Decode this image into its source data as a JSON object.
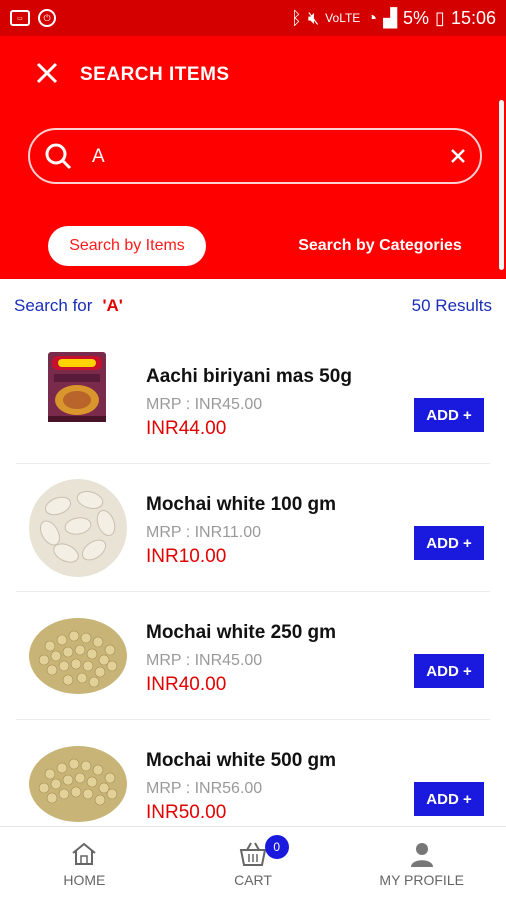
{
  "status_bar": {
    "battery": "5%",
    "time": "15:06",
    "network": "VoLTE"
  },
  "header": {
    "title": "SEARCH ITEMS",
    "search_value": "A",
    "tabs": [
      {
        "label": "Search by Items",
        "active": true
      },
      {
        "label": "Search by Categories",
        "active": false
      }
    ]
  },
  "results": {
    "search_for_label": "Search for",
    "query": "'A'",
    "count": "50 Results"
  },
  "items": [
    {
      "name": "Aachi biriyani mas 50g",
      "mrp": "MRP : INR45.00",
      "price": "INR44.00",
      "add_label": "ADD +",
      "image": "aachi-packet"
    },
    {
      "name": "Mochai white 100 gm",
      "mrp": "MRP : INR11.00",
      "price": "INR10.00",
      "add_label": "ADD +",
      "image": "white-beans"
    },
    {
      "name": "Mochai white 250 gm",
      "mrp": "MRP : INR45.00",
      "price": "INR40.00",
      "add_label": "ADD +",
      "image": "small-beans"
    },
    {
      "name": "Mochai white 500 gm",
      "mrp": "MRP : INR56.00",
      "price": "INR50.00",
      "add_label": "ADD +",
      "image": "small-beans"
    }
  ],
  "bottom_nav": {
    "home": "HOME",
    "cart": "CART",
    "cart_count": "0",
    "profile": "MY PROFILE"
  },
  "colors": {
    "header_red": "#ff0000",
    "status_red": "#d40000",
    "accent_blue": "#1a1adf",
    "price_red": "#e00000"
  }
}
